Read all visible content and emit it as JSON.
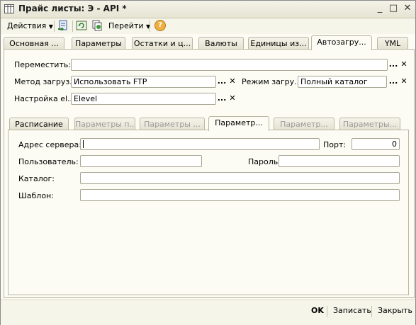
{
  "window": {
    "title": "Прайс листы: Э - API *",
    "minimize": "_",
    "maximize": "□",
    "close": "✕"
  },
  "toolbar": {
    "actions": "Действия",
    "goto": "Перейти",
    "help": "?"
  },
  "tabs": [
    {
      "label": "Основная ..."
    },
    {
      "label": "Параметры"
    },
    {
      "label": "Остатки и ц..."
    },
    {
      "label": "Валюты"
    },
    {
      "label": "Единицы из..."
    },
    {
      "label": "Автозагру..."
    },
    {
      "label": "YML"
    }
  ],
  "form": {
    "move_label": "Переместить:",
    "move_value": "",
    "method_label": "Метод загруз...",
    "method_value": "Использовать FTP",
    "mode_label": "Режим загру...",
    "mode_value": "Полный каталог",
    "settings_label": "Настройка el...",
    "settings_value": "Elevel"
  },
  "subtabs": [
    {
      "label": "Расписание"
    },
    {
      "label": "Параметры п..."
    },
    {
      "label": "Параметры ..."
    },
    {
      "label": "Параметр..."
    },
    {
      "label": "Параметр..."
    },
    {
      "label": "Параметры..."
    }
  ],
  "ftp": {
    "server_label": "Адрес сервера:",
    "server_value": "",
    "port_label": "Порт:",
    "port_value": "0",
    "user_label": "Пользователь:",
    "user_value": "",
    "password_label": "Пароль:",
    "password_value": "",
    "catalog_label": "Каталог:",
    "catalog_value": "",
    "template_label": "Шаблон:",
    "template_value": ""
  },
  "footer": {
    "ok": "OK",
    "save": "Записать",
    "close": "Закрыть"
  }
}
